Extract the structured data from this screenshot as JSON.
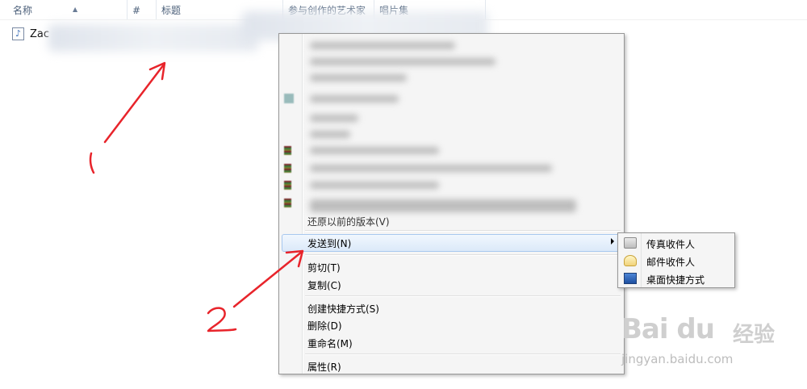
{
  "columns": [
    "名称",
    "#",
    "标题",
    "参与创作的艺术家",
    "唱片集"
  ],
  "file": {
    "name": "Zac"
  },
  "menu": {
    "items": [
      {
        "label": "还原以前的版本(V)"
      },
      {
        "label": "发送到(N)"
      },
      {
        "label": "剪切(T)"
      },
      {
        "label": "复制(C)"
      },
      {
        "label": "创建快捷方式(S)"
      },
      {
        "label": "删除(D)"
      },
      {
        "label": "重命名(M)"
      },
      {
        "label": "属性(R)"
      }
    ]
  },
  "submenu": {
    "items": [
      {
        "label": "传真收件人",
        "icon": "fax-icon"
      },
      {
        "label": "邮件收件人",
        "icon": "mail-icon"
      },
      {
        "label": "桌面快捷方式",
        "icon": "desktop-icon"
      }
    ]
  },
  "annotations": {
    "one": "1",
    "two": "2",
    "color": "#e8242b"
  },
  "watermark": {
    "logo": "Bai du",
    "cn": "经验",
    "url": "jingyan.baidu.com"
  }
}
